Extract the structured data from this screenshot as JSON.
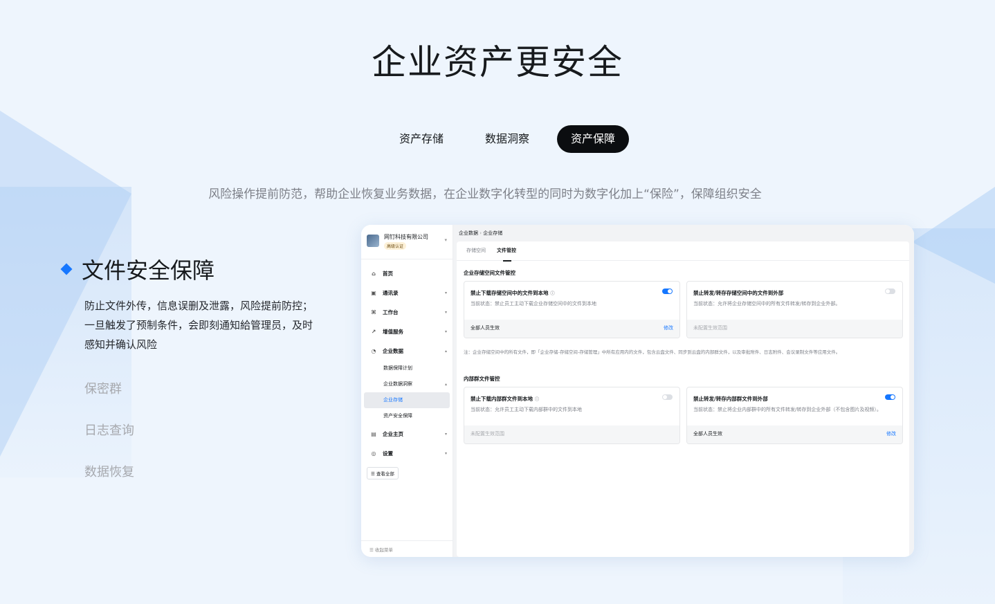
{
  "hero": {
    "title": "企业资产更安全",
    "tabs": [
      {
        "label": "资产存储",
        "active": false
      },
      {
        "label": "数据洞察",
        "active": false
      },
      {
        "label": "资产保障",
        "active": true
      }
    ],
    "subtitle": "风险操作提前防范，帮助企业恢复业务数据，在企业数字化转型的同时为数字化加上“保险”，保障组织安全"
  },
  "feature": {
    "title": "文件安全保障",
    "description": "防止文件外传，信息误删及泄露，风险提前防控；一旦触发了预制条件，会即刻通知給管理员，及时感知并确认风险",
    "others": [
      "保密群",
      "日志查询",
      "数据恢复"
    ]
  },
  "mock": {
    "org": {
      "name": "网钉科技有限公司",
      "badge": "高级认证"
    },
    "nav": [
      {
        "label": "首页",
        "icon": "home-icon",
        "caret": ""
      },
      {
        "label": "通讯录",
        "icon": "contacts-icon",
        "caret": "▾"
      },
      {
        "label": "工作台",
        "icon": "grid-icon",
        "caret": "▾"
      },
      {
        "label": "增值服务",
        "icon": "chart-icon",
        "caret": "▾"
      },
      {
        "label": "企业数据",
        "icon": "data-icon",
        "caret": "▴"
      }
    ],
    "sub_nav": [
      {
        "label": "数据保障计划",
        "caret": ""
      },
      {
        "label": "企业数据洞察",
        "caret": "▴"
      },
      {
        "label": "企业存储",
        "caret": "",
        "active": true
      },
      {
        "label": "资产安全保障",
        "caret": ""
      }
    ],
    "nav_bottom": [
      {
        "label": "企业主页",
        "icon": "building-icon",
        "caret": "▾"
      },
      {
        "label": "设置",
        "icon": "settings-icon",
        "caret": "▾"
      }
    ],
    "view_all": "查看全部",
    "collapse": "收起菜单",
    "breadcrumb": {
      "parent": "企业数据",
      "sep": "›",
      "current": "企业存储"
    },
    "tabs": [
      {
        "label": "存储空间",
        "active": false
      },
      {
        "label": "文件管控",
        "active": true
      }
    ],
    "section1": {
      "title": "企业存储空间文件管控",
      "cards": [
        {
          "title": "禁止下载存储空间中的文件到本地",
          "info": "ⓘ",
          "status": "当前状态：禁止员工主动下载企业存储空间中的文件到本地",
          "footer": "全部人员生效",
          "footer_muted": false,
          "link": "修改",
          "toggle_on": true
        },
        {
          "title": "禁止转发/转存存储空间中的文件到外部",
          "info": "",
          "status": "当前状态：允许将企业存储空间中的所有文件转发/转存到企业外部。",
          "footer": "未配置生效范围",
          "footer_muted": true,
          "link": "",
          "toggle_on": false
        }
      ],
      "note": "注：企业存储空间中的所有文件，即「企业存储-存储空间-存储管理」中所有应用内的文件，包含云盘文件、同步到云盘的内部群文件，以及审批附件、日志附件、会议录制文件等应用文件。"
    },
    "section2": {
      "title": "内部群文件管控",
      "cards": [
        {
          "title": "禁止下载内部群文件到本地",
          "info": "ⓘ",
          "status": "当前状态：允许员工主动下载内部群中的文件到本地",
          "footer": "未配置生效范围",
          "footer_muted": true,
          "link": "",
          "toggle_on": false
        },
        {
          "title": "禁止转发/转存内部群文件到外部",
          "info": "",
          "status": "当前状态：禁止将企业内部群中的所有文件转发/转存到企业外部（不包含图片及视频）。",
          "footer": "全部人员生效",
          "footer_muted": false,
          "link": "修改",
          "toggle_on": true
        }
      ]
    }
  }
}
